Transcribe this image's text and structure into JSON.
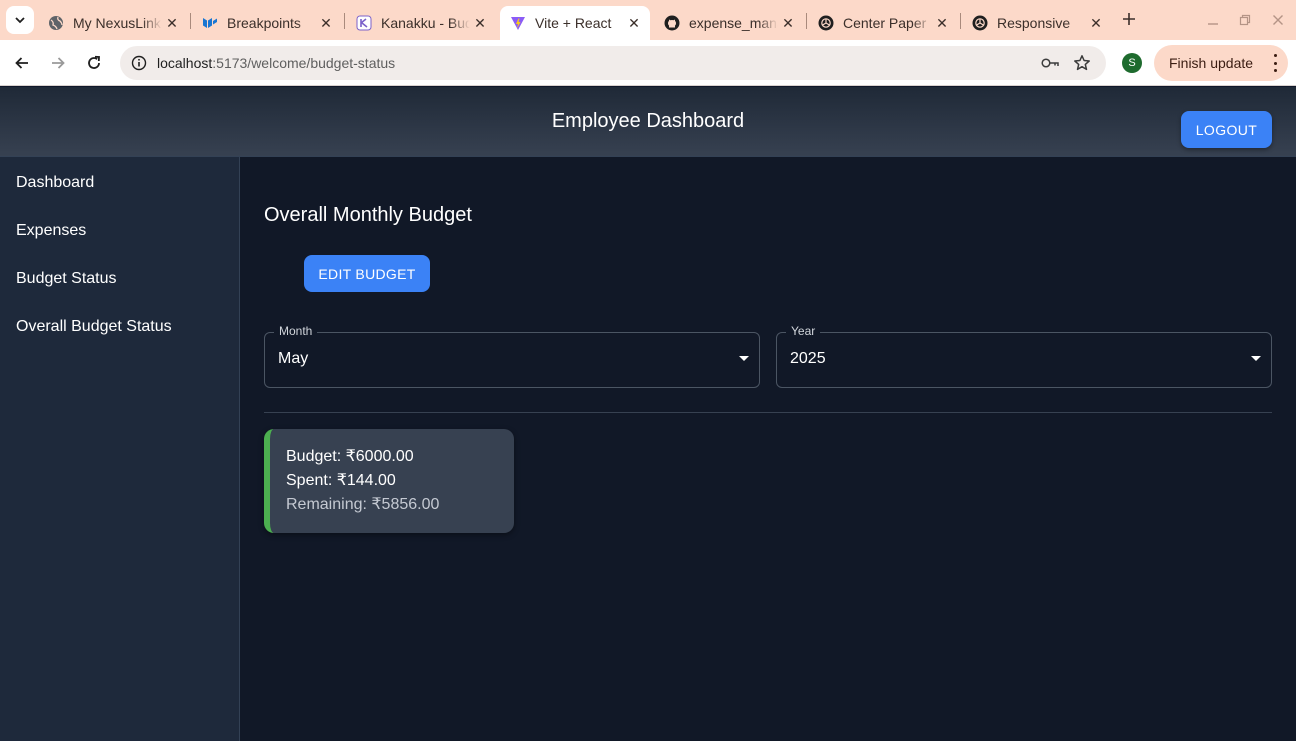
{
  "browser": {
    "tabs": [
      {
        "title": "My NexusLink",
        "icon": "globe-icon",
        "active": false
      },
      {
        "title": "Breakpoints",
        "icon": "mui-logo-icon",
        "active": false
      },
      {
        "title": "Kanakku - Budget",
        "icon": "kanakku-logo-icon",
        "active": false
      },
      {
        "title": "Vite + React",
        "icon": "vite-logo-icon",
        "active": true
      },
      {
        "title": "expense_manager",
        "icon": "github-logo-icon",
        "active": false
      },
      {
        "title": "Center Paper",
        "icon": "openai-logo-icon",
        "active": false
      },
      {
        "title": "Responsive",
        "icon": "openai-logo-icon",
        "active": false
      }
    ],
    "url_host": "localhost",
    "url_path": ":5173/welcome/budget-status",
    "profile_initial": "S",
    "finish_update_label": "Finish update"
  },
  "header": {
    "title": "Employee Dashboard",
    "logout_label": "LOGOUT",
    "gradient_top": "#1f2937",
    "gradient_bottom": "#374151"
  },
  "sidebar": {
    "items": [
      {
        "label": "Dashboard"
      },
      {
        "label": "Expenses"
      },
      {
        "label": "Budget Status"
      },
      {
        "label": "Overall Budget Status"
      }
    ]
  },
  "main": {
    "heading": "Overall Monthly Budget",
    "edit_button_label": "EDIT BUDGET",
    "month_field": {
      "label": "Month",
      "value": "May"
    },
    "year_field": {
      "label": "Year",
      "value": "2025"
    },
    "budget_card": {
      "budget_text": "Budget: ₹6000.00",
      "spent_text": "Spent: ₹144.00",
      "remaining_text": "Remaining: ₹5856.00",
      "accent_color": "#4caf50"
    }
  },
  "colors": {
    "accent": "#3b82f6",
    "page_background": "#111827",
    "sidebar_background": "#1e293b",
    "tab_strip": "#fcd9c9"
  }
}
